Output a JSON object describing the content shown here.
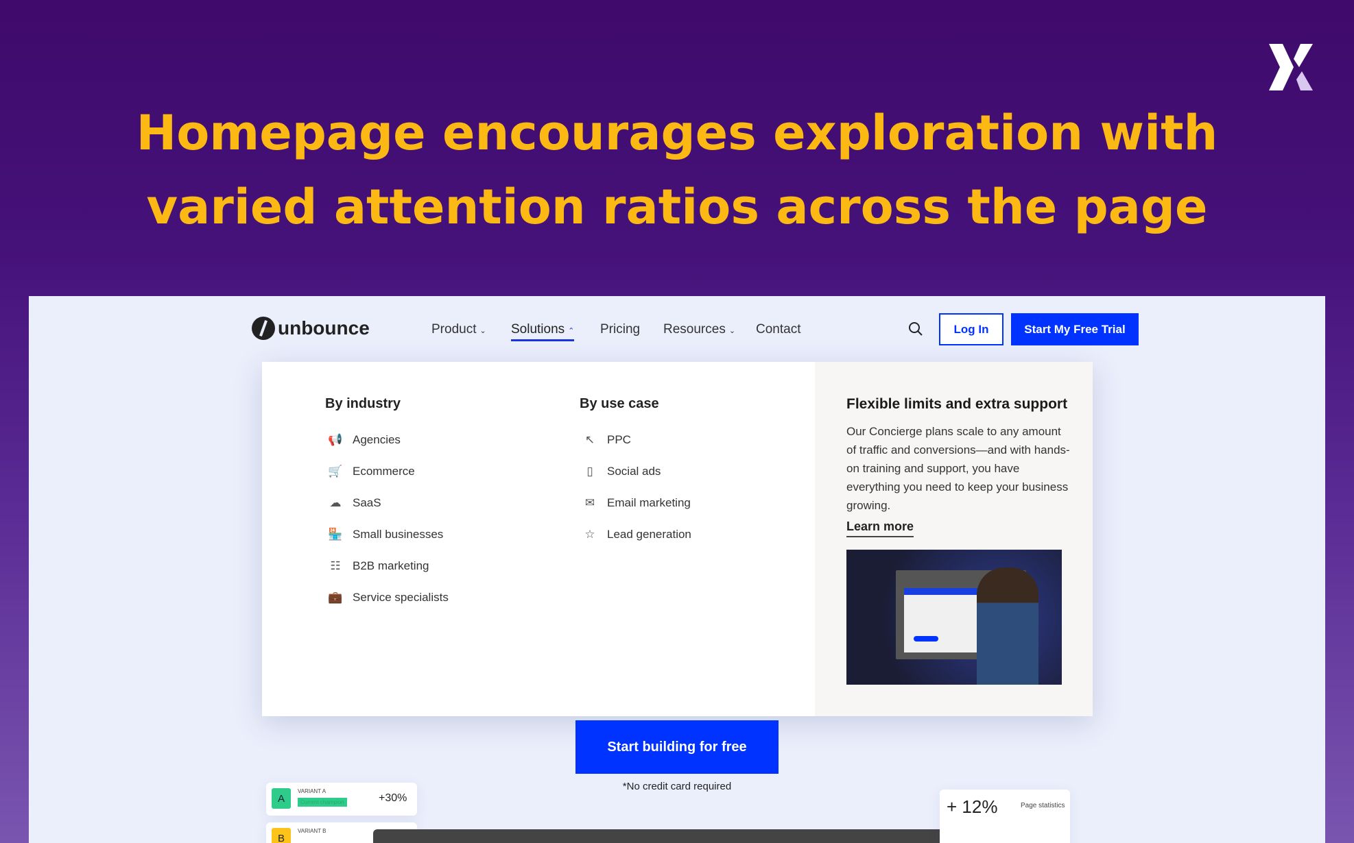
{
  "headline": {
    "line1": "Homepage encourages exploration with",
    "line2": "varied attention ratios across the page"
  },
  "brand_colors": {
    "headline": "#fdb913",
    "primary": "#0033ff",
    "background": "#3f0a6b"
  },
  "nav": {
    "logo": "unbounce",
    "items": [
      {
        "label": "Product",
        "icon": "chevron-down"
      },
      {
        "label": "Solutions",
        "icon": "chevron-up",
        "active": true
      },
      {
        "label": "Pricing"
      },
      {
        "label": "Resources",
        "icon": "chevron-down"
      },
      {
        "label": "Contact"
      }
    ],
    "login": "Log In",
    "trial": "Start My Free Trial"
  },
  "dropdown": {
    "industry": {
      "heading": "By industry",
      "items": [
        {
          "label": "Agencies",
          "icon": "megaphone"
        },
        {
          "label": "Ecommerce",
          "icon": "cart"
        },
        {
          "label": "SaaS",
          "icon": "cloud"
        },
        {
          "label": "Small businesses",
          "icon": "storefront"
        },
        {
          "label": "B2B marketing",
          "icon": "b2b"
        },
        {
          "label": "Service specialists",
          "icon": "briefcase"
        }
      ]
    },
    "use_case": {
      "heading": "By use case",
      "items": [
        {
          "label": "PPC",
          "icon": "cursor"
        },
        {
          "label": "Social ads",
          "icon": "phone"
        },
        {
          "label": "Email marketing",
          "icon": "envelope"
        },
        {
          "label": "Lead generation",
          "icon": "star"
        }
      ]
    },
    "side": {
      "heading": "Flexible limits and extra support",
      "body": "Our Concierge plans scale to any amount of traffic and conversions—and with hands-on training and support, you have everything you need to keep your business growing.",
      "link": "Learn more"
    }
  },
  "hero": {
    "cta": "Start building for free",
    "note": "*No credit card required"
  },
  "variants": {
    "a": {
      "letter": "A",
      "label": "VARIANT A",
      "tag": "Current champion",
      "value": "+30%"
    },
    "b": {
      "letter": "B",
      "label": "VARIANT B"
    }
  },
  "stats": {
    "value": "+ 12%",
    "label": "Page statistics"
  }
}
